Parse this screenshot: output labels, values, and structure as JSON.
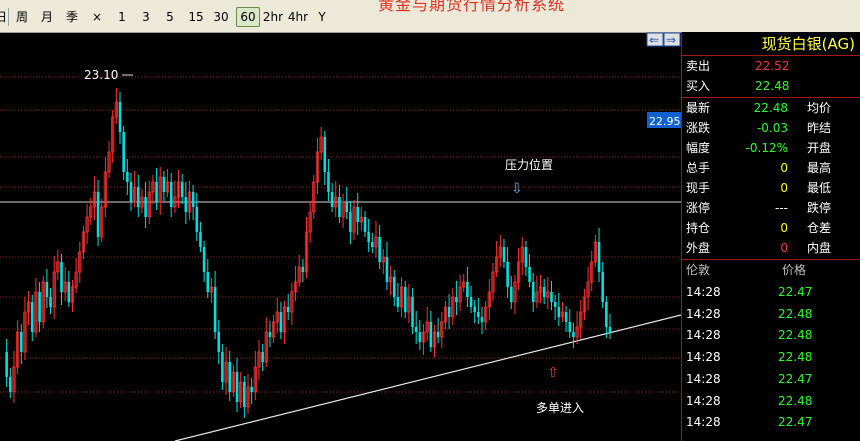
{
  "toolbar": {
    "items": [
      "日",
      "周",
      "月",
      "季",
      "×",
      "1",
      "3",
      "5",
      "15",
      "30",
      "60",
      "2hr",
      "4hr",
      "Y"
    ],
    "active": "60",
    "title": "黄金与期货行情分析系统"
  },
  "chart": {
    "high_label": "23.10",
    "price_tag": "22.95",
    "resistance_label": "压力位置",
    "long_entry_label": "多单进入",
    "arrow_up": "⇧",
    "arrow_down": "⇩",
    "nav_left": "⇐",
    "nav_right": "⇒"
  },
  "panel": {
    "title": "现货白银(AG)",
    "bid_ask": [
      {
        "label": "卖出",
        "value": "22.52",
        "color": "red"
      },
      {
        "label": "买入",
        "value": "22.48",
        "color": "green"
      }
    ],
    "stats": [
      {
        "label": "最新",
        "value": "22.48",
        "color": "green",
        "label2": "均价"
      },
      {
        "label": "涨跌",
        "value": "-0.03",
        "color": "green",
        "label2": "昨结"
      },
      {
        "label": "幅度",
        "value": "-0.12%",
        "color": "green",
        "label2": "开盘"
      },
      {
        "label": "总手",
        "value": "0",
        "color": "yellow",
        "label2": "最高"
      },
      {
        "label": "现手",
        "value": "0",
        "color": "yellow",
        "label2": "最低"
      },
      {
        "label": "涨停",
        "value": "---",
        "color": "white",
        "label2": "跌停"
      },
      {
        "label": "持仓",
        "value": "0",
        "color": "yellow",
        "label2": "仓差"
      },
      {
        "label": "外盘",
        "value": "0",
        "color": "red",
        "label2": "内盘"
      }
    ],
    "ticks_header": {
      "time": "伦敦",
      "price": "价格"
    },
    "ticks": [
      {
        "time": "14:28",
        "price": "22.47"
      },
      {
        "time": "14:28",
        "price": "22.48"
      },
      {
        "time": "14:28",
        "price": "22.48"
      },
      {
        "time": "14:28",
        "price": "22.48"
      },
      {
        "time": "14:28",
        "price": "22.47"
      },
      {
        "time": "14:28",
        "price": "22.48"
      },
      {
        "time": "14:28",
        "price": "22.47"
      }
    ]
  },
  "colors": {
    "up": "#FF3030",
    "down": "#00E0E0",
    "grid": "#A01818",
    "background": "#000000"
  }
}
